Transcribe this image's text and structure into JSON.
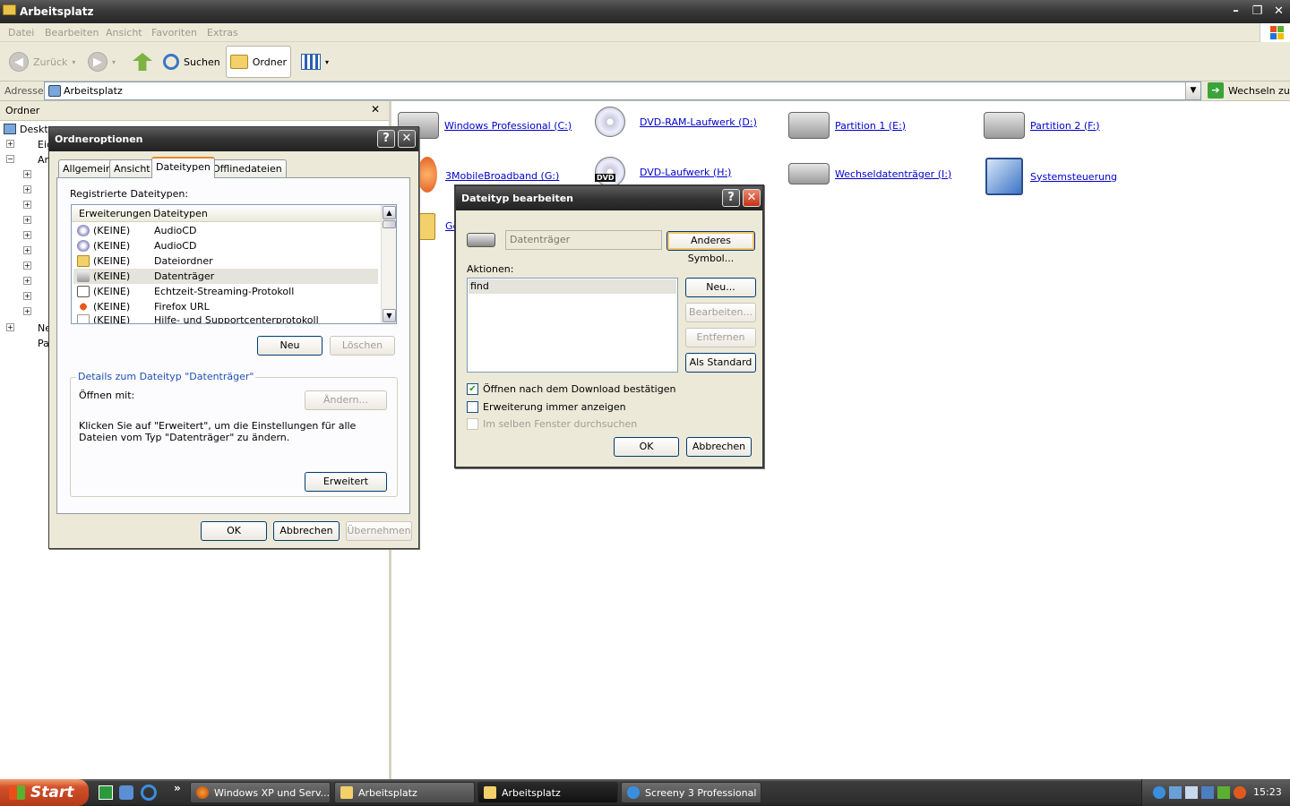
{
  "window": {
    "title": "Arbeitsplatz",
    "minimize": "–",
    "restore": "❐",
    "close": "✕"
  },
  "menu": [
    "Datei",
    "Bearbeiten",
    "Ansicht",
    "Favoriten",
    "Extras"
  ],
  "toolbar": {
    "back": "Zurück",
    "search": "Suchen",
    "folders": "Ordner"
  },
  "address": {
    "label": "Adresse",
    "value": "Arbeitsplatz",
    "go": "Wechseln zu"
  },
  "folders_pane": {
    "title": "Ordner",
    "close": "✕",
    "items": [
      "Deskto",
      "Eig",
      "Ar",
      "Ne",
      "Pa"
    ]
  },
  "drives": [
    {
      "label": "Windows Professional (C:)",
      "kind": "hdd"
    },
    {
      "label": "DVD-RAM-Laufwerk (D:)",
      "kind": "cd"
    },
    {
      "label": "Partition 1 (E:)",
      "kind": "hdd"
    },
    {
      "label": "Partition 2 (F:)",
      "kind": "hdd"
    },
    {
      "label": "3MobileBroadband (G:)",
      "kind": "app"
    },
    {
      "label": "DVD-Laufwerk (H:)",
      "kind": "dvd"
    },
    {
      "label": "Wechseldatenträger (I:)",
      "kind": "hdd"
    },
    {
      "label": "Systemsteuerung",
      "kind": "control"
    },
    {
      "label": "Ge",
      "kind": "folder"
    }
  ],
  "dvd_badge": "DVD",
  "folder_options": {
    "title": "Ordneroptionen",
    "help": "?",
    "close": "✕",
    "tabs": [
      "Allgemein",
      "Ansicht",
      "Dateitypen",
      "Offlinedateien"
    ],
    "registered_label": "Registrierte Dateitypen:",
    "columns": [
      "Erweiterungen",
      "Dateitypen"
    ],
    "rows": [
      {
        "ext": "(KEINE)",
        "type": "AudioCD"
      },
      {
        "ext": "(KEINE)",
        "type": "AudioCD"
      },
      {
        "ext": "(KEINE)",
        "type": "Dateiordner"
      },
      {
        "ext": "(KEINE)",
        "type": "Datenträger"
      },
      {
        "ext": "(KEINE)",
        "type": "Echtzeit-Streaming-Protokoll"
      },
      {
        "ext": "(KEINE)",
        "type": "Firefox URL"
      },
      {
        "ext": "(KEINE)",
        "type": "Hilfe- und Supportcenterprotokoll"
      }
    ],
    "new_btn": "Neu",
    "delete_btn": "Löschen",
    "details_title": "Details zum Dateityp \"Datenträger\"",
    "open_with": "Öffnen mit:",
    "change_btn": "Ändern...",
    "details_text": "Klicken Sie auf \"Erweitert\", um die Einstellungen für alle Dateien vom Typ \"Datenträger\" zu ändern.",
    "advanced_btn": "Erweitert",
    "ok": "OK",
    "cancel": "Abbrechen",
    "apply": "Übernehmen"
  },
  "edit_type": {
    "title": "Dateityp bearbeiten",
    "help": "?",
    "close": "✕",
    "name_value": "Datenträger",
    "change_icon": "Anderes Symbol...",
    "actions_label": "Aktionen:",
    "actions": [
      "find"
    ],
    "new_btn": "Neu...",
    "edit_btn": "Bearbeiten...",
    "remove_btn": "Entfernen",
    "default_btn": "Als Standard",
    "chk_confirm_open": "Öffnen nach dem Download bestätigen",
    "chk_confirm_open_state": true,
    "chk_always_ext": "Erweiterung immer anzeigen",
    "chk_always_ext_state": false,
    "chk_same_window": "Im selben Fenster durchsuchen",
    "chk_same_window_state": false,
    "ok": "OK",
    "cancel": "Abbrechen"
  },
  "taskbar": {
    "start": "Start",
    "more": "»",
    "tasks": [
      "Windows XP und Serv...",
      "Arbeitsplatz",
      "Arbeitsplatz",
      "Screeny 3 Professional"
    ],
    "clock": "15:23"
  }
}
